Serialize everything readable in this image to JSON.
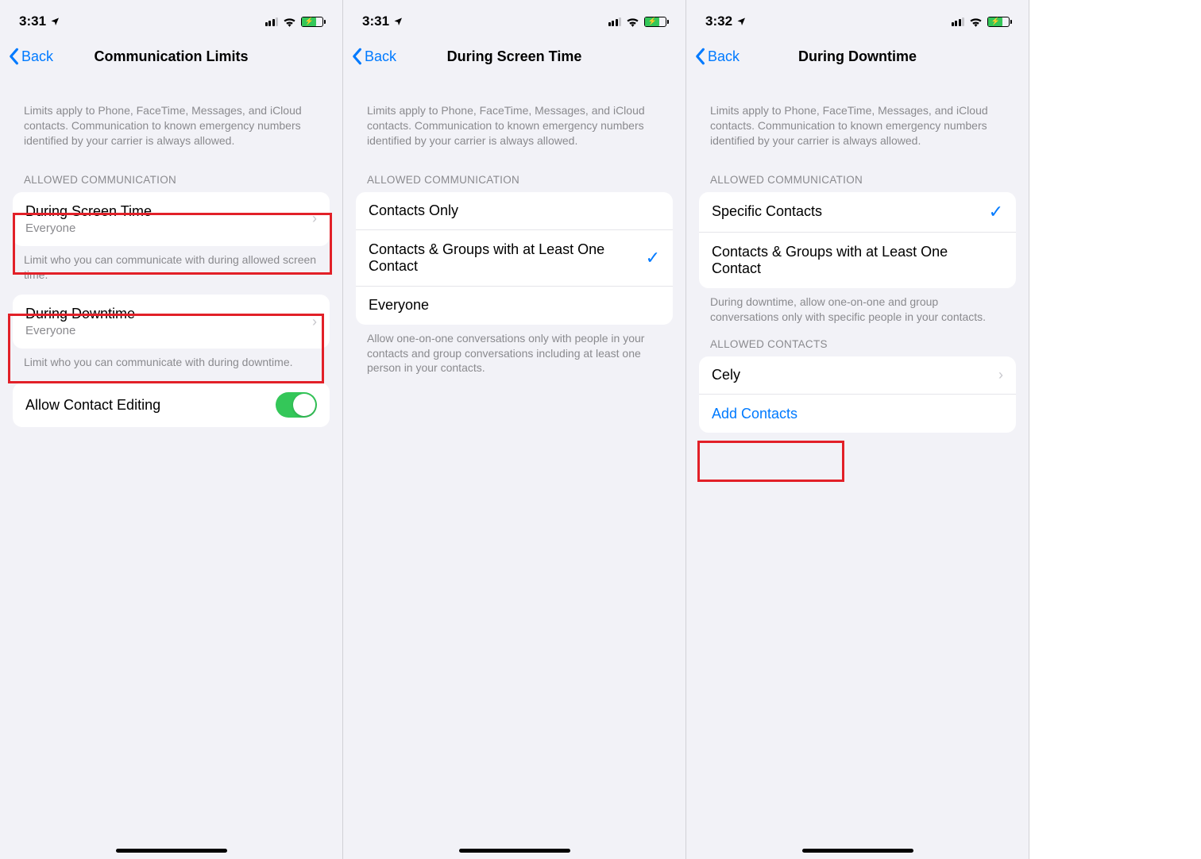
{
  "screens": [
    {
      "status": {
        "time": "3:31"
      },
      "nav": {
        "back": "Back",
        "title": "Communication Limits"
      },
      "description": "Limits apply to Phone, FaceTime, Messages, and iCloud contacts. Communication to known emergency numbers identified by your carrier is always allowed.",
      "sections": {
        "allowed_header": "ALLOWED COMMUNICATION",
        "during_screen_time": {
          "title": "During Screen Time",
          "subtitle": "Everyone"
        },
        "footer1": "Limit who you can communicate with during allowed screen time.",
        "during_downtime": {
          "title": "During Downtime",
          "subtitle": "Everyone"
        },
        "footer2": "Limit who you can communicate with during downtime.",
        "allow_editing": "Allow Contact Editing"
      }
    },
    {
      "status": {
        "time": "3:31"
      },
      "nav": {
        "back": "Back",
        "title": "During Screen Time"
      },
      "description": "Limits apply to Phone, FaceTime, Messages, and iCloud contacts. Communication to known emergency numbers identified by your carrier is always allowed.",
      "sections": {
        "allowed_header": "ALLOWED COMMUNICATION",
        "options": [
          {
            "label": "Contacts Only",
            "selected": false
          },
          {
            "label": "Contacts & Groups with at Least One Contact",
            "selected": true
          },
          {
            "label": "Everyone",
            "selected": false
          }
        ],
        "footer": "Allow one-on-one conversations only with people in your contacts and group conversations including at least one person in your contacts."
      }
    },
    {
      "status": {
        "time": "3:32"
      },
      "nav": {
        "back": "Back",
        "title": "During Downtime"
      },
      "description": "Limits apply to Phone, FaceTime, Messages, and iCloud contacts. Communication to known emergency numbers identified by your carrier is always allowed.",
      "sections": {
        "allowed_header": "ALLOWED COMMUNICATION",
        "options": [
          {
            "label": "Specific Contacts",
            "selected": true
          },
          {
            "label": "Contacts & Groups with at Least One Contact",
            "selected": false
          }
        ],
        "footer": "During downtime, allow one-on-one and group conversations only with specific people in your contacts.",
        "contacts_header": "ALLOWED CONTACTS",
        "contacts": [
          "Cely"
        ],
        "add_contacts": "Add Contacts"
      }
    }
  ]
}
